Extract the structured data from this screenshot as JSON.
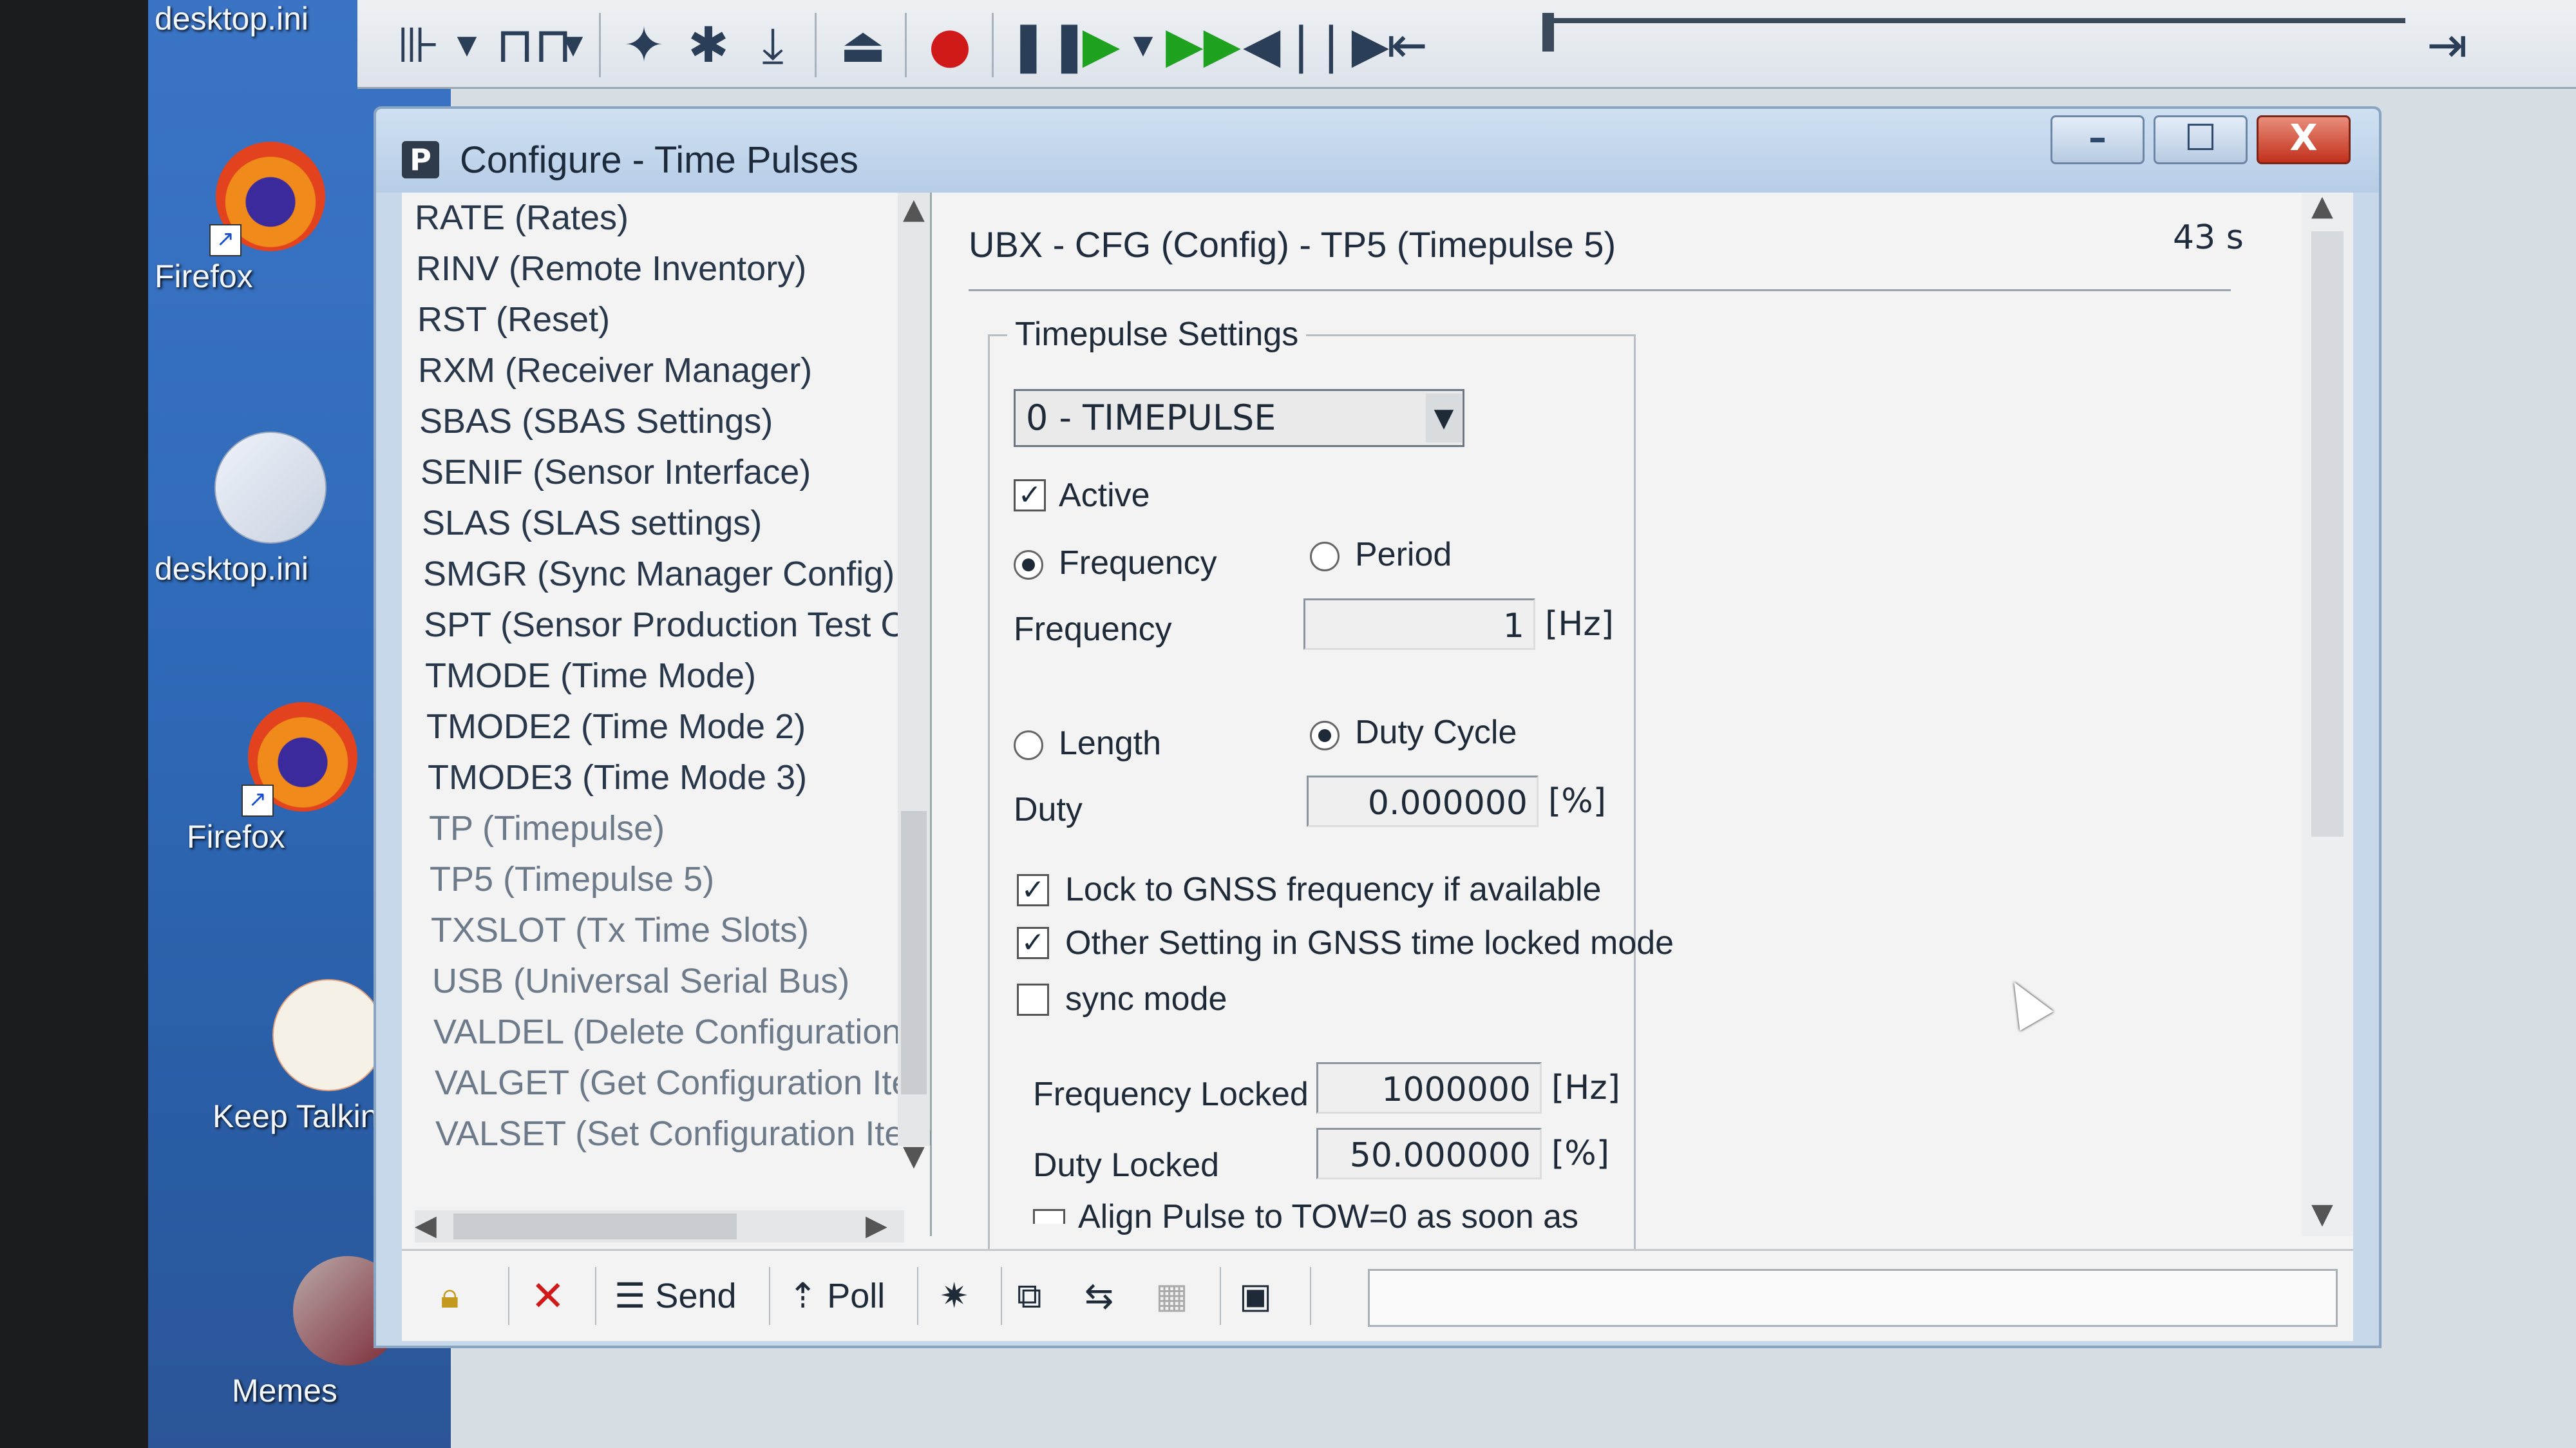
{
  "desktop": {
    "icons": [
      {
        "label": "desktop.ini",
        "icon": "file-icon"
      },
      {
        "label": "Firefox",
        "icon": "firefox-icon"
      },
      {
        "label": "desktop.ini",
        "icon": "file-icon"
      },
      {
        "label": "Firefox",
        "icon": "firefox-icon"
      },
      {
        "label": "Keep Talking and Nobo...",
        "icon": "pdf-icon"
      },
      {
        "label": "Memes",
        "icon": "folder-image-icon"
      }
    ]
  },
  "toolbar": {
    "buttons": [
      "port-icon",
      "baud-icon",
      "wizard-icon",
      "debug-icon",
      "download-icon",
      "eject-icon",
      "record-icon",
      "pause-icon",
      "play-icon",
      "fast-forward-icon",
      "step-back-icon",
      "step-forward-icon",
      "rewind-start-icon",
      "skip-end-icon"
    ]
  },
  "window": {
    "title": "Configure - Time Pulses",
    "controls": {
      "minimize": "–",
      "maximize": "☐",
      "close": "X"
    }
  },
  "list": {
    "items": [
      "RATE (Rates)",
      "RINV (Remote Inventory)",
      "RST (Reset)",
      "RXM (Receiver Manager)",
      "SBAS (SBAS Settings)",
      "SENIF (Sensor Interface)",
      "SLAS (SLAS settings)",
      "SMGR (Sync Manager Config)",
      "SPT (Sensor Production Test Co",
      "TMODE (Time Mode)",
      "TMODE2 (Time Mode 2)",
      "TMODE3 (Time Mode 3)",
      "TP (Timepulse)",
      "TP5 (Timepulse 5)",
      "TXSLOT (Tx Time Slots)",
      "USB (Universal Serial Bus)",
      "VALDEL (Delete Configuration It",
      "VALGET (Get Configuration Iten",
      "VALSET (Set Configuration Item"
    ]
  },
  "panel": {
    "message_title": "UBX - CFG (Config) - TP5 (Timepulse 5)",
    "age": "43 s",
    "group_label": "Timepulse Settings",
    "timepulse_select": "0 - TIMEPULSE",
    "active_label": "Active",
    "frequency_radio": "Frequency",
    "period_radio": "Period",
    "frequency_label": "Frequency",
    "frequency_value": "1",
    "hz_unit": "[Hz]",
    "length_radio": "Length",
    "duty_cycle_radio": "Duty Cycle",
    "duty_label": "Duty",
    "duty_value": "0.000000",
    "pct_unit": "[%]",
    "lock_gnss_label": "Lock to GNSS frequency if available",
    "other_setting_label": "Other Setting in GNSS time locked mode",
    "sync_mode_label": "sync mode",
    "frequency_locked_label": "Frequency Locked",
    "frequency_locked_value": "1000000",
    "duty_locked_label": "Duty Locked",
    "duty_locked_value": "50.000000",
    "align_label": "Align Pulse to TOW=0 as soon as"
  },
  "bottombar": {
    "send_label": "Send",
    "poll_label": "Poll"
  }
}
